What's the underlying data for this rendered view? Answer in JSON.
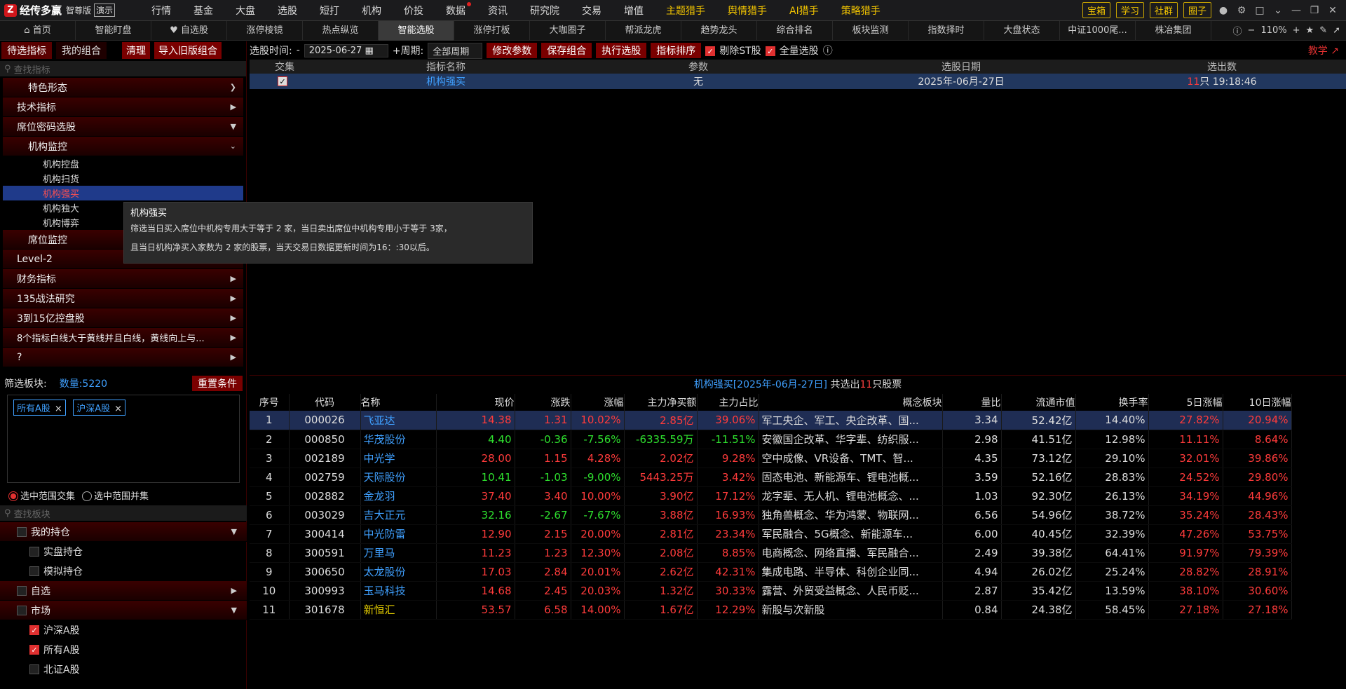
{
  "app": {
    "name": "经传多赢",
    "edition": "智尊版",
    "demo": "演示"
  },
  "menu": [
    "行情",
    "基金",
    "大盘",
    "选股",
    "短打",
    "机构",
    "价投",
    "数据",
    "资讯",
    "研究院",
    "交易",
    "增值"
  ],
  "menu_highlight": [
    "主题猎手",
    "舆情猎手",
    "AI猎手",
    "策略猎手"
  ],
  "right_buttons": [
    "宝箱",
    "学习",
    "社群",
    "圈子"
  ],
  "tabs": [
    "首页",
    "智能盯盘",
    "自选股",
    "涨停棱镜",
    "热点纵览",
    "智能选股",
    "涨停打板",
    "大咖圈子",
    "帮派龙虎",
    "趋势龙头",
    "综合排名",
    "板块监测",
    "指数择时",
    "大盘状态",
    "中证1000尾...",
    "株冶集团"
  ],
  "zoom": "110%",
  "left": {
    "tab1": "待选指标",
    "tab2": "我的组合",
    "clear": "清理",
    "import": "导入旧版组合",
    "search_placeholder": "查找指标",
    "tree": {
      "t0": "特色形态",
      "t1": "技术指标",
      "t2": "席位密码选股",
      "t3": "机构监控",
      "leaves": [
        "机构控盘",
        "机构扫货",
        "机构强买",
        "机构独大",
        "机构博弈"
      ],
      "t4": "席位监控",
      "t5": "Level-2",
      "t6": "财务指标",
      "t7": "135战法研究",
      "t8": "3到15亿控盘股",
      "t9": "8个指标白线大于黄线并且白线，黄线向上与...",
      "t10": "?"
    },
    "filter_label": "筛选板块:",
    "count": "数量:5220",
    "reset": "重置条件",
    "tags": [
      "所有A股",
      "沪深A股"
    ],
    "radio1": "选中范围交集",
    "radio2": "选中范围并集",
    "search2_placeholder": "查找板块",
    "my_hold": "我的持仓",
    "real_hold": "实盘持仓",
    "sim_hold": "模拟持仓",
    "self": "自选",
    "market": "市场",
    "m1": "沪深A股",
    "m2": "所有A股",
    "m3": "北证A股"
  },
  "ctrl": {
    "time_label": "选股时间:",
    "date": "2025-06-27",
    "period_label": "周期:",
    "period": "全部周期",
    "b1": "修改参数",
    "b2": "保存组合",
    "b3": "执行选股",
    "b4": "指标排序",
    "c1": "剔除ST股",
    "c2": "全量选股",
    "help": "教学"
  },
  "upper": {
    "headers": [
      "交集",
      "指标名称",
      "参数",
      "选股日期",
      "选出数"
    ],
    "row": {
      "name": "机构强买",
      "param": "无",
      "date": "2025年-06月-27日",
      "count": "11",
      "count_suffix": "只 19:18:46"
    }
  },
  "tooltip": {
    "title": "机构强买",
    "line1": "筛选当日买入席位中机构专用大于等于 2 家，当日卖出席位中机构专用小于等于 3家，",
    "line2": "且当日机构净买入家数为 2 家的股票，当天交易日数据更新时间为16：:30以后。"
  },
  "result": {
    "prefix": "机构强买[2025年-06月-27日]",
    "mid": " 共选出",
    "count": "11",
    "suffix": "只股票",
    "headers": [
      "序号",
      "代码",
      "名称",
      "现价",
      "涨跌",
      "涨幅",
      "主力净买额",
      "主力占比",
      "概念板块",
      "量比",
      "流通市值",
      "换手率",
      "5日涨幅",
      "10日涨幅"
    ],
    "rows": [
      [
        "1",
        "000026",
        "飞亚达",
        "14.38",
        "1.31",
        "10.02%",
        "2.85亿",
        "39.06%",
        "军工央企、军工、央企改革、国...",
        "3.34",
        "52.42亿",
        "14.40%",
        "27.82%",
        "20.94%"
      ],
      [
        "2",
        "000850",
        "华茂股份",
        "4.40",
        "-0.36",
        "-7.56%",
        "-6335.59万",
        "-11.51%",
        "安徽国企改革、华字辈、纺织服...",
        "2.98",
        "41.51亿",
        "12.98%",
        "11.11%",
        "8.64%"
      ],
      [
        "3",
        "002189",
        "中光学",
        "28.00",
        "1.15",
        "4.28%",
        "2.02亿",
        "9.28%",
        "空中成像、VR设备、TMT、智...",
        "4.35",
        "73.12亿",
        "29.10%",
        "32.01%",
        "39.86%"
      ],
      [
        "4",
        "002759",
        "天际股份",
        "10.41",
        "-1.03",
        "-9.00%",
        "5443.25万",
        "3.42%",
        "固态电池、新能源车、锂电池概...",
        "3.59",
        "52.16亿",
        "28.83%",
        "24.52%",
        "29.80%"
      ],
      [
        "5",
        "002882",
        "金龙羽",
        "37.40",
        "3.40",
        "10.00%",
        "3.90亿",
        "17.12%",
        "龙字辈、无人机、锂电池概念、...",
        "1.03",
        "92.30亿",
        "26.13%",
        "34.19%",
        "44.96%"
      ],
      [
        "6",
        "003029",
        "吉大正元",
        "32.16",
        "-2.67",
        "-7.67%",
        "3.88亿",
        "16.93%",
        "独角兽概念、华为鸿蒙、物联网...",
        "6.56",
        "54.96亿",
        "38.72%",
        "35.24%",
        "28.43%"
      ],
      [
        "7",
        "300414",
        "中光防雷",
        "12.90",
        "2.15",
        "20.00%",
        "2.81亿",
        "23.34%",
        "军民融合、5G概念、新能源车...",
        "6.00",
        "40.45亿",
        "32.39%",
        "47.26%",
        "53.75%"
      ],
      [
        "8",
        "300591",
        "万里马",
        "11.23",
        "1.23",
        "12.30%",
        "2.08亿",
        "8.85%",
        "电商概念、网络直播、军民融合...",
        "2.49",
        "39.38亿",
        "64.41%",
        "91.97%",
        "79.39%"
      ],
      [
        "9",
        "300650",
        "太龙股份",
        "17.03",
        "2.84",
        "20.01%",
        "2.62亿",
        "42.31%",
        "集成电路、半导体、科创企业同...",
        "4.94",
        "26.02亿",
        "25.24%",
        "28.82%",
        "28.91%"
      ],
      [
        "10",
        "300993",
        "玉马科技",
        "14.68",
        "2.45",
        "20.03%",
        "1.32亿",
        "30.33%",
        "露营、外贸受益概念、人民币贬...",
        "2.87",
        "35.42亿",
        "13.59%",
        "38.10%",
        "30.60%"
      ],
      [
        "11",
        "301678",
        "新恒汇",
        "53.57",
        "6.58",
        "14.00%",
        "1.67亿",
        "12.29%",
        "新股与次新股",
        "0.84",
        "24.38亿",
        "58.45%",
        "27.18%",
        "27.18%"
      ]
    ]
  }
}
